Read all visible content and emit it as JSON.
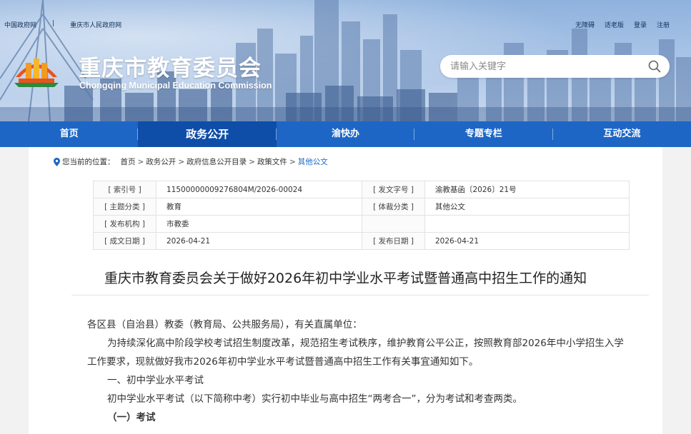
{
  "top_links": {
    "left": [
      "中国政府网",
      "|",
      "重庆市人民政府网"
    ],
    "right": [
      "无障碍",
      "适老版",
      "登录",
      "注册"
    ]
  },
  "site": {
    "title": "重庆市教育委员会",
    "subtitle": "Chongqing Municipal Education Commission"
  },
  "search": {
    "placeholder": "请输入关键字",
    "value": ""
  },
  "nav": {
    "items": [
      {
        "label": "首页",
        "active": false
      },
      {
        "label": "政务公开",
        "active": true
      },
      {
        "label": "渝快办",
        "active": false
      },
      {
        "label": "专题专栏",
        "active": false
      },
      {
        "label": "互动交流",
        "active": false
      }
    ]
  },
  "breadcrumb": {
    "prefix": "您当前的位置：",
    "items": [
      "首页",
      "政务公开",
      "政府信息公开目录",
      "政策文件",
      "其他公文"
    ],
    "separator": ">"
  },
  "meta": {
    "rows": [
      [
        "[ 索引号 ]",
        "11500000009276804M/2026-00024",
        "[ 发文字号 ]",
        "渝教基函〔2026〕21号"
      ],
      [
        "[ 主题分类 ]",
        "教育",
        "[ 体裁分类 ]",
        "其他公文"
      ],
      [
        "[ 发布机构 ]",
        "市教委",
        "",
        ""
      ],
      [
        "[ 成文日期 ]",
        "2026-04-21",
        "[ 发布日期 ]",
        "2026-04-21"
      ]
    ]
  },
  "document": {
    "title": "重庆市教育委员会关于做好2026年初中学业水平考试暨普通高中招生工作的通知",
    "paragraphs": [
      "各区县（自治县）教委（教育局、公共服务局），有关直属单位：",
      "为持续深化高中阶段学校考试招生制度改革，规范招生考试秩序，维护教育公平公正，按照教育部2026年中小学招生入学工作要求，现就做好我市2026年初中学业水平考试暨普通高中招生工作有关事宜通知如下。",
      "一、初中学业水平考试",
      "初中学业水平考试（以下简称中考）实行初中毕业与高中招生“两考合一”，分为考试和考查两类。",
      "（一）考试"
    ]
  },
  "colors": {
    "nav_bg": "#1d66c5",
    "nav_active": "#0f4ea8",
    "breadcrumb_current": "#1d66c5"
  }
}
